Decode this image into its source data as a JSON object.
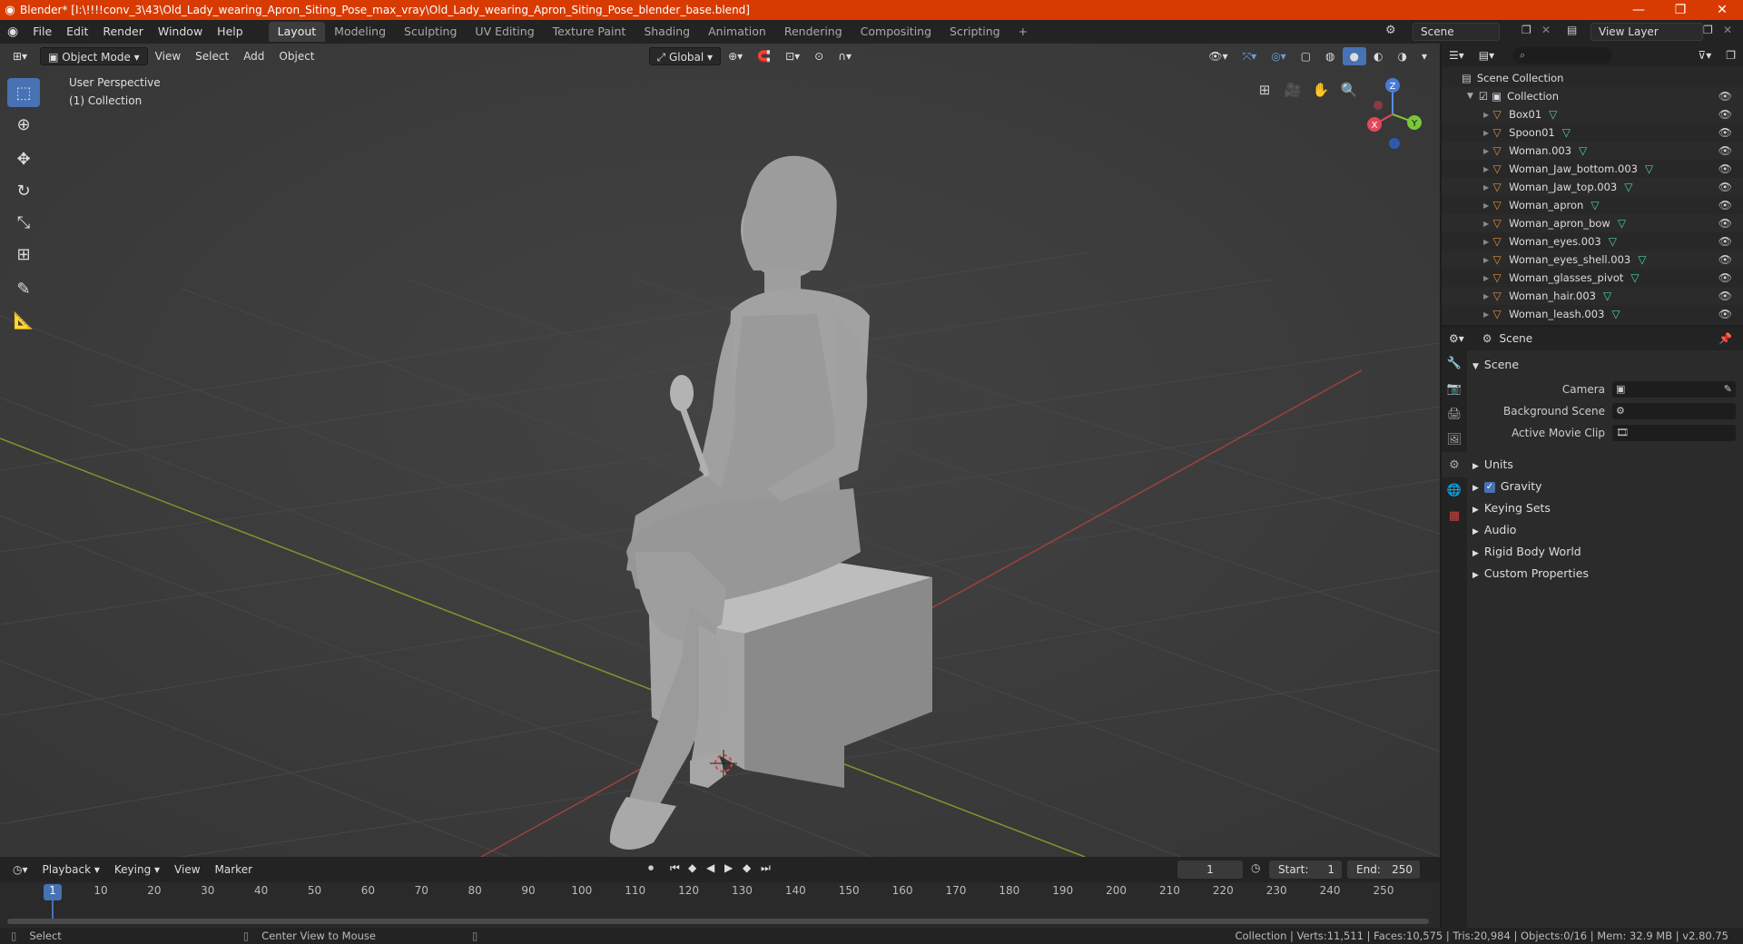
{
  "window": {
    "title": "Blender* [I:\\!!!!conv_3\\43\\Old_Lady_wearing_Apron_Siting_Pose_max_vray\\Old_Lady_wearing_Apron_Siting_Pose_blender_base.blend]",
    "minimize": "—",
    "maximize": "❐",
    "close": "✕"
  },
  "menu": [
    "File",
    "Edit",
    "Render",
    "Window",
    "Help"
  ],
  "workspaces": [
    "Layout",
    "Modeling",
    "Sculpting",
    "UV Editing",
    "Texture Paint",
    "Shading",
    "Animation",
    "Rendering",
    "Compositing",
    "Scripting"
  ],
  "active_workspace": "Layout",
  "add_workspace": "+",
  "scene_name": "Scene",
  "view_layer": "View Layer",
  "viewport": {
    "mode": "Object Mode",
    "menus": [
      "View",
      "Select",
      "Add",
      "Object"
    ],
    "orientation": "Global",
    "label_perspective": "User Perspective",
    "label_collection": "(1) Collection",
    "gizmo": {
      "x": "X",
      "y": "Y",
      "z": "Z"
    }
  },
  "timeline": {
    "menus": [
      "Playback",
      "Keying",
      "View",
      "Marker"
    ],
    "current_frame": "1",
    "start_label": "Start:",
    "start": "1",
    "end_label": "End:",
    "end": "250",
    "frame_numbers": [
      "1",
      "10",
      "20",
      "30",
      "40",
      "50",
      "60",
      "70",
      "80",
      "90",
      "100",
      "110",
      "120",
      "130",
      "140",
      "150",
      "160",
      "170",
      "180",
      "190",
      "200",
      "210",
      "220",
      "230",
      "240",
      "250"
    ]
  },
  "status": {
    "select": "Select",
    "center_view": "Center View to Mouse",
    "info": "Collection | Verts:11,511 | Faces:10,575 | Tris:20,984 | Objects:0/16 | Mem: 32.9 MB | v2.80.75"
  },
  "outliner": {
    "root": "Scene Collection",
    "collection": "Collection",
    "objects": [
      "Box01",
      "Spoon01",
      "Woman.003",
      "Woman_Jaw_bottom.003",
      "Woman_Jaw_top.003",
      "Woman_apron",
      "Woman_apron_bow",
      "Woman_eyes.003",
      "Woman_eyes_shell.003",
      "Woman_glasses_pivot",
      "Woman_hair.003",
      "Woman_leash.003"
    ]
  },
  "properties": {
    "context": "Scene",
    "panel": "Scene",
    "camera_label": "Camera",
    "background_scene_label": "Background Scene",
    "active_movie_clip_label": "Active Movie Clip",
    "subpanels": [
      "Units",
      "Gravity",
      "Keying Sets",
      "Audio",
      "Rigid Body World",
      "Custom Properties"
    ]
  },
  "colors": {
    "titlebar": "#d83b01",
    "accent": "#4772b3",
    "object_icon": "#e08c3c",
    "mesh_icon": "#4fd1a8"
  }
}
